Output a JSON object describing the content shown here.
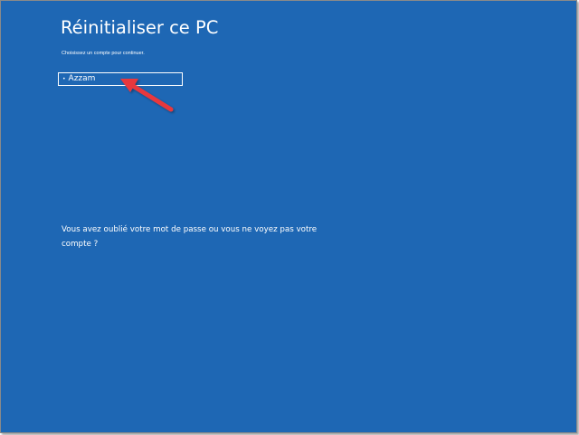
{
  "page": {
    "title": "Réinitialiser ce PC",
    "subtitle": "Choisissez un compte pour continuer."
  },
  "accounts": [
    {
      "bullet": "•",
      "name": "Azzam"
    }
  ],
  "forgot_link": "Vous avez oublié votre mot de passe ou vous ne voyez pas votre compte ?",
  "colors": {
    "background": "#1e67b4",
    "text": "#ffffff",
    "annotation_arrow": "#e8383d"
  },
  "icons": {
    "annotation": "arrow-pointer-icon"
  }
}
